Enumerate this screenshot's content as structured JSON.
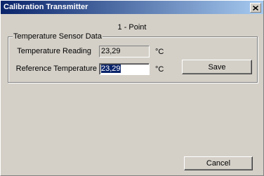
{
  "window": {
    "title": "Calibration Transmitter",
    "close_icon": "close-icon"
  },
  "mode_label": "1 - Point",
  "group": {
    "legend": "Temperature Sensor Data",
    "reading_label": "Temperature Reading",
    "reading_value": "23,29",
    "reading_unit": "°C",
    "reference_label": "Reference Temperature",
    "reference_value": "23,29",
    "reference_unit": "°C"
  },
  "buttons": {
    "save_label": "Save",
    "cancel_label": "Cancel"
  },
  "colors": {
    "titlebar_start": "#0a246a",
    "titlebar_end": "#a6caf0",
    "face": "#d4d0c8",
    "selection": "#0a246a"
  }
}
